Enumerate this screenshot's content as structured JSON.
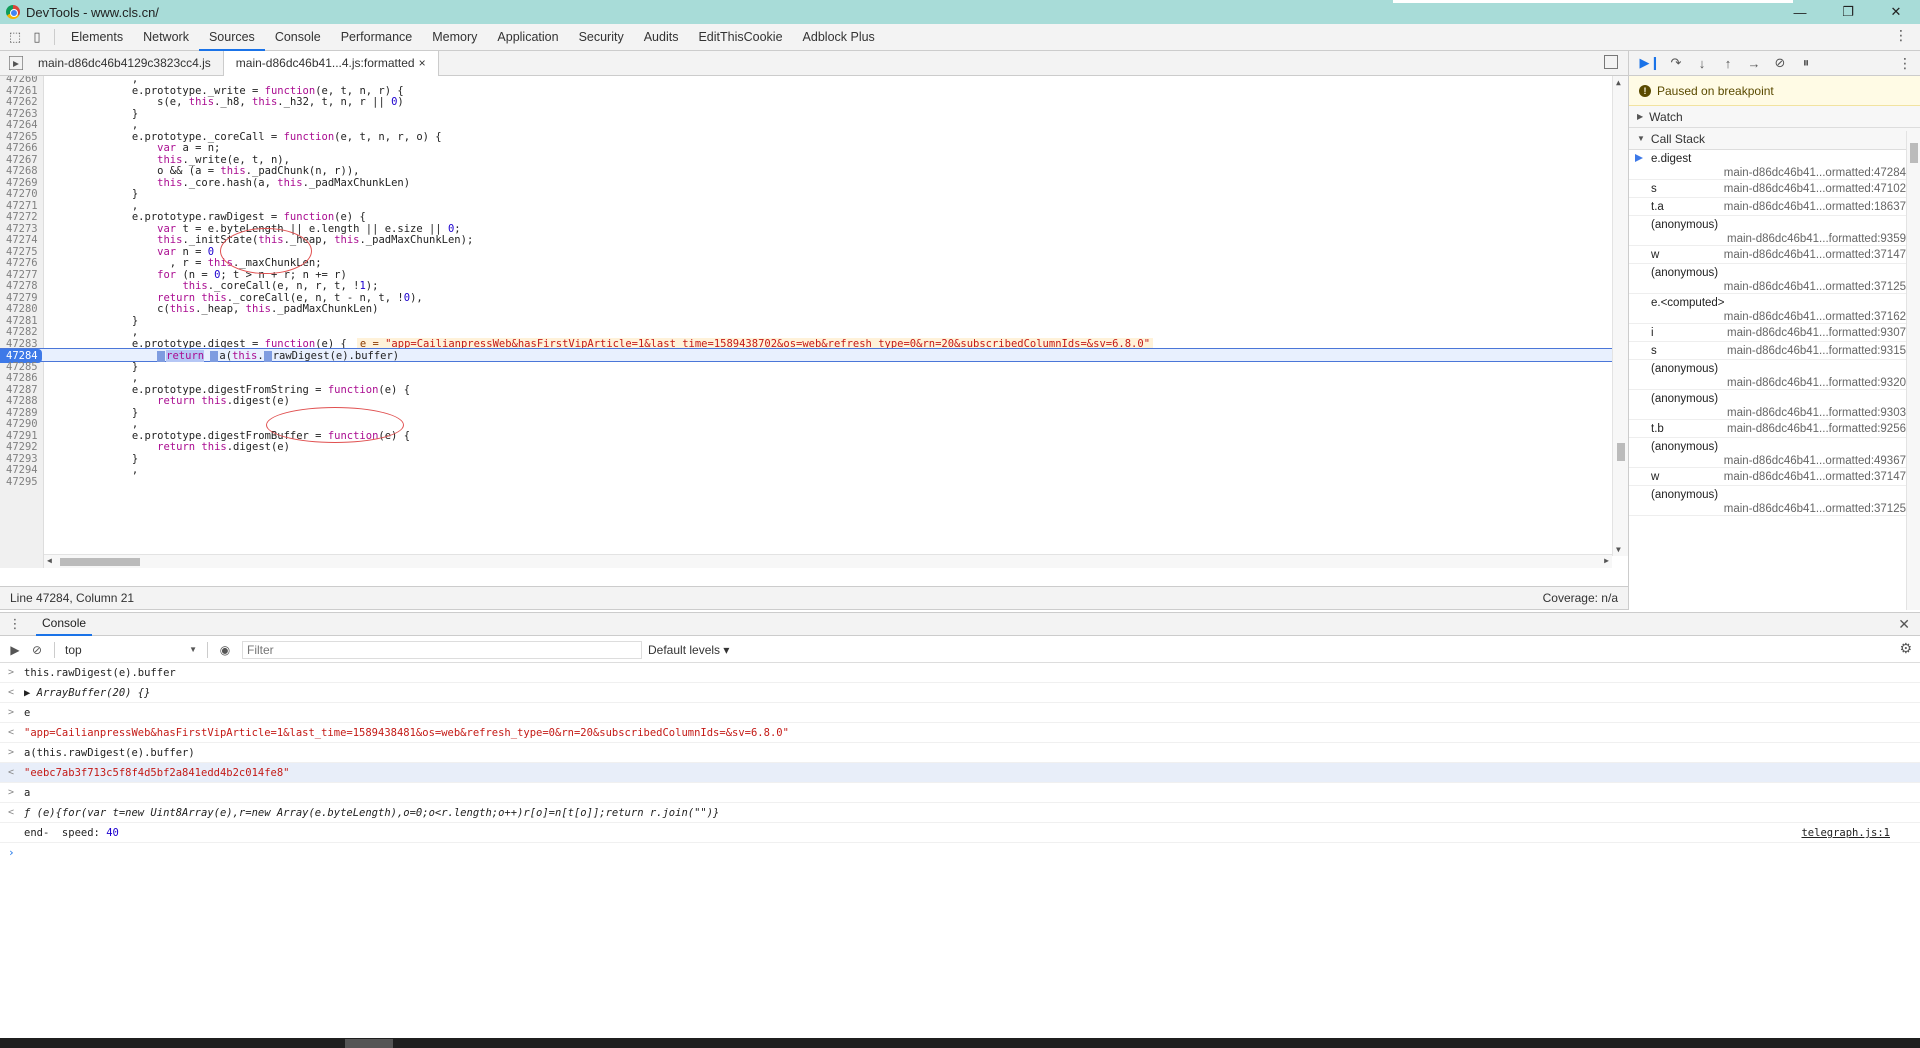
{
  "window": {
    "title": "DevTools - www.cls.cn/",
    "controls": [
      "—",
      "❐",
      "✕"
    ]
  },
  "main_tabs": [
    "Elements",
    "Network",
    "Sources",
    "Console",
    "Performance",
    "Memory",
    "Application",
    "Security",
    "Audits",
    "EditThisCookie",
    "Adblock Plus"
  ],
  "active_main_tab": "Sources",
  "file_tabs": [
    {
      "label": "main-d86dc46b4129c3823cc4.js",
      "active": false
    },
    {
      "label": "main-d86dc46b41...4.js:formatted",
      "active": true,
      "close": "×"
    }
  ],
  "code": {
    "lines": [
      {
        "n": "47260",
        "src": "            ,"
      },
      {
        "n": "47261",
        "src": "            e.prototype._write = function(e, t, n, r) {"
      },
      {
        "n": "47262",
        "src": "                s(e, this._h8, this._h32, t, n, r || 0)"
      },
      {
        "n": "47263",
        "src": "            }"
      },
      {
        "n": "47264",
        "src": "            ,"
      },
      {
        "n": "47265",
        "src": "            e.prototype._coreCall = function(e, t, n, r, o) {"
      },
      {
        "n": "47266",
        "src": "                var a = n;"
      },
      {
        "n": "47267",
        "src": "                this._write(e, t, n),"
      },
      {
        "n": "47268",
        "src": "                o && (a = this._padChunk(n, r)),"
      },
      {
        "n": "47269",
        "src": "                this._core.hash(a, this._padMaxChunkLen)"
      },
      {
        "n": "47270",
        "src": "            }"
      },
      {
        "n": "47271",
        "src": "            ,"
      },
      {
        "n": "47272",
        "src": "            e.prototype.rawDigest = function(e) {"
      },
      {
        "n": "47273",
        "src": "                var t = e.byteLength || e.length || e.size || 0;"
      },
      {
        "n": "47274",
        "src": "                this._initState(this._heap, this._padMaxChunkLen);"
      },
      {
        "n": "47275",
        "src": "                var n = 0"
      },
      {
        "n": "47276",
        "src": "                  , r = this._maxChunkLen;"
      },
      {
        "n": "47277",
        "src": "                for (n = 0; t > n + r; n += r)"
      },
      {
        "n": "47278",
        "src": "                    this._coreCall(e, n, r, t, !1);"
      },
      {
        "n": "47279",
        "src": "                return this._coreCall(e, n, t - n, t, !0),"
      },
      {
        "n": "47280",
        "src": "                c(this._heap, this._padMaxChunkLen)"
      },
      {
        "n": "47281",
        "src": "            }"
      },
      {
        "n": "47282",
        "src": "            ,"
      },
      {
        "n": "47283",
        "src": "            e.prototype.digest = function(e) {"
      },
      {
        "n": "47284",
        "src": "                return a(this.rawDigest(e).buffer)"
      },
      {
        "n": "47285",
        "src": "            }"
      },
      {
        "n": "47286",
        "src": "            ,"
      },
      {
        "n": "47287",
        "src": "            e.prototype.digestFromString = function(e) {"
      },
      {
        "n": "47288",
        "src": "                return this.digest(e)"
      },
      {
        "n": "47289",
        "src": "            }"
      },
      {
        "n": "47290",
        "src": "            ,"
      },
      {
        "n": "47291",
        "src": "            e.prototype.digestFromBuffer = function(e) {"
      },
      {
        "n": "47292",
        "src": "                return this.digest(e)"
      },
      {
        "n": "47293",
        "src": "            }"
      },
      {
        "n": "47294",
        "src": "            ,"
      },
      {
        "n": "47295",
        "src": ""
      }
    ],
    "current_line": "47284",
    "inline_value_name": "e =",
    "inline_value": "\"app=CailianpressWeb&hasFirstVipArticle=1&last_time=1589438702&os=web&refresh_type=0&rn=20&subscribedColumnIds=&sv=6.8.0\"",
    "exec_line_parts": {
      "kw": "return",
      "a": "a(",
      "this": "this",
      "rest": "rawDigest(e).buffer)"
    }
  },
  "status": {
    "position": "Line 47284, Column 21",
    "coverage": "Coverage: n/a"
  },
  "debugger": {
    "toolbar_icons": [
      "resume-icon",
      "step-over-icon",
      "step-into-icon",
      "step-out-icon",
      "step-icon",
      "deactivate-breakpoints-icon",
      "pause-on-exceptions-icon"
    ],
    "paused_text": "Paused on breakpoint",
    "watch_label": "Watch",
    "callstack_label": "Call Stack",
    "frames": [
      {
        "name": "e.digest",
        "loc": "main-d86dc46b41...ormatted:47284",
        "two_line": true,
        "current": true
      },
      {
        "name": "s",
        "loc": "main-d86dc46b41...ormatted:47102",
        "two_line": false
      },
      {
        "name": "t.a",
        "loc": "main-d86dc46b41...ormatted:18637",
        "two_line": false
      },
      {
        "name": "(anonymous)",
        "loc": "main-d86dc46b41...formatted:9359",
        "two_line": true
      },
      {
        "name": "w",
        "loc": "main-d86dc46b41...ormatted:37147",
        "two_line": false
      },
      {
        "name": "(anonymous)",
        "loc": "main-d86dc46b41...ormatted:37125",
        "two_line": true
      },
      {
        "name": "e.<computed>",
        "loc": "main-d86dc46b41...ormatted:37162",
        "two_line": true
      },
      {
        "name": "i",
        "loc": "main-d86dc46b41...formatted:9307",
        "two_line": false
      },
      {
        "name": "s",
        "loc": "main-d86dc46b41...formatted:9315",
        "two_line": false
      },
      {
        "name": "(anonymous)",
        "loc": "main-d86dc46b41...formatted:9320",
        "two_line": true
      },
      {
        "name": "(anonymous)",
        "loc": "main-d86dc46b41...formatted:9303",
        "two_line": true
      },
      {
        "name": "t.b",
        "loc": "main-d86dc46b41...formatted:9256",
        "two_line": false
      },
      {
        "name": "(anonymous)",
        "loc": "main-d86dc46b41...ormatted:49367",
        "two_line": true
      },
      {
        "name": "w",
        "loc": "main-d86dc46b41...ormatted:37147",
        "two_line": false
      },
      {
        "name": "(anonymous)",
        "loc": "main-d86dc46b41...ormatted:37125",
        "two_line": true
      }
    ]
  },
  "console": {
    "tab_label": "Console",
    "context": "top",
    "filter_placeholder": "Filter",
    "levels": "Default levels ▾",
    "entries": [
      {
        "type": "in",
        "prefix": ">",
        "text": "this.rawDigest(e).buffer"
      },
      {
        "type": "out",
        "prefix": "<",
        "text": "▶ ArrayBuffer(20) {}",
        "italic": true
      },
      {
        "type": "in",
        "prefix": ">",
        "text": "e"
      },
      {
        "type": "out-str",
        "prefix": "<",
        "text": "\"app=CailianpressWeb&hasFirstVipArticle=1&last_time=1589438481&os=web&refresh_type=0&rn=20&subscribedColumnIds=&sv=6.8.0\""
      },
      {
        "type": "in",
        "prefix": ">",
        "text": "a(this.rawDigest(e).buffer)"
      },
      {
        "type": "out-str",
        "prefix": "<",
        "text": "\"eebc7ab3f713c5f8f4d5bf2a841edd4b2c014fe8\"",
        "highlight": true
      },
      {
        "type": "in",
        "prefix": ">",
        "text": "a"
      },
      {
        "type": "out",
        "prefix": "<",
        "text": "ƒ (e){for(var t=new Uint8Array(e),r=new Array(e.byteLength),o=0;o<r.length;o++)r[o]=n[t[o]];return r.join(\"\")}",
        "italic": true
      },
      {
        "type": "log",
        "prefix": "",
        "text": "end-  speed: ",
        "num": "40",
        "link": "telegraph.js:1"
      }
    ]
  }
}
